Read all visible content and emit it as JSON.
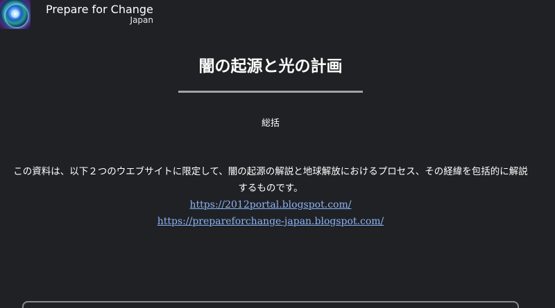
{
  "header": {
    "site_title": "Prepare for Change",
    "site_subtitle": "Japan"
  },
  "main": {
    "title": "闇の起源と光の計画",
    "section_label": "総括",
    "intro": "この資料は、以下２つのウエブサイトに限定して、闇の起源の解説と地球解放におけるプロセス、その経緯を包括的に解説するものです。",
    "links": [
      {
        "text": "https://2012portal.blogspot.com/"
      },
      {
        "text": "https://prepareforchange-japan.blogspot.com/"
      }
    ]
  },
  "colors": {
    "background": "#202124",
    "text": "#ffffff",
    "link": "#8ab4f8",
    "rule": "#a3a3a3"
  },
  "icons": {
    "logo": "earth-logo-icon"
  }
}
